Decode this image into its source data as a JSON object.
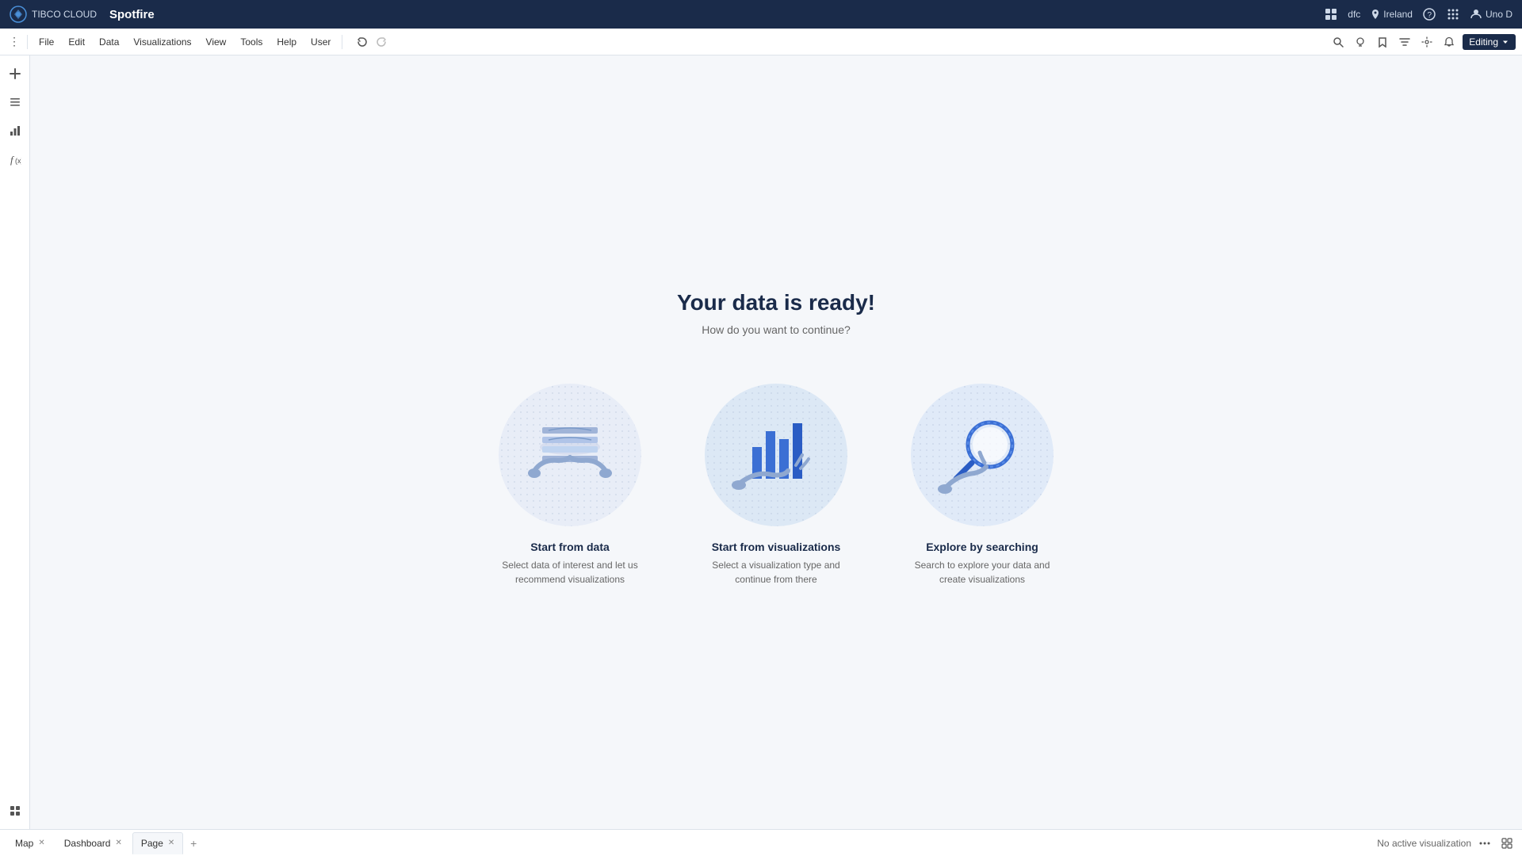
{
  "app": {
    "brand": "TIBCO CLOUD",
    "name": "Spotfire",
    "logo_alt": "TIBCO Logo"
  },
  "topbar": {
    "db_label": "dfc",
    "location": "Ireland",
    "user": "Uno D"
  },
  "menubar": {
    "items": [
      "File",
      "Edit",
      "Data",
      "Visualizations",
      "View",
      "Tools",
      "Help",
      "User"
    ],
    "editing_label": "Editing"
  },
  "hero": {
    "title": "Your data is ready!",
    "subtitle": "How do you want to continue?"
  },
  "cards": [
    {
      "id": "start-from-data",
      "title": "Start from data",
      "desc": "Select data of interest and let us recommend visualizations"
    },
    {
      "id": "start-from-visualizations",
      "title": "Start from visualizations",
      "desc": "Select a visualization type and continue from there"
    },
    {
      "id": "explore-by-searching",
      "title": "Explore by searching",
      "desc": "Search to explore your data and create visualizations"
    }
  ],
  "tabs": [
    {
      "label": "Map",
      "closable": true
    },
    {
      "label": "Dashboard",
      "closable": true
    },
    {
      "label": "Page",
      "closable": true,
      "active": true
    }
  ],
  "bottombar": {
    "status": "No active visualization"
  },
  "sidebar": {
    "icons": [
      {
        "name": "add-icon",
        "glyph": "+"
      },
      {
        "name": "pages-icon",
        "glyph": "☰"
      },
      {
        "name": "charts-icon",
        "glyph": "📊"
      },
      {
        "name": "formula-icon",
        "glyph": "ƒ"
      },
      {
        "name": "layers-icon",
        "glyph": "⊞"
      }
    ]
  }
}
